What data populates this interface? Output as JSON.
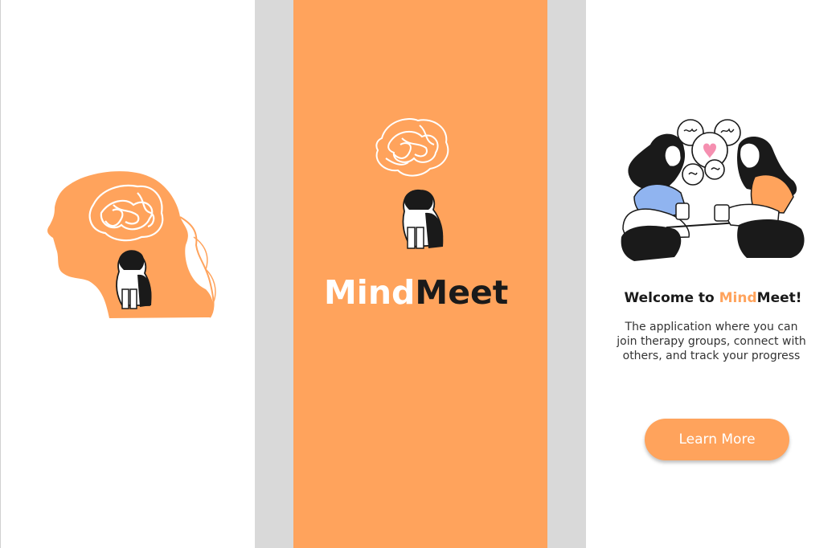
{
  "colors": {
    "brand_orange": "#ffa35c",
    "dark": "#1a1a1a",
    "gap_gray": "#d9d9d9",
    "shirt_blue": "#90b4f0"
  },
  "splash": {
    "logo_part1": "Mind",
    "logo_part2": "Meet"
  },
  "welcome": {
    "prefix": "Welcome to ",
    "brand_part1": "Mind",
    "brand_part2": "Meet!",
    "description": "The application where you can join therapy groups, connect with others, and track your progress",
    "learn_more_label": "Learn More"
  },
  "icons": {
    "head": "head-silhouette-illustration",
    "tangle": "tangled-thoughts-icon",
    "person": "sad-person-illustration",
    "conversation": "two-women-talking-illustration"
  }
}
